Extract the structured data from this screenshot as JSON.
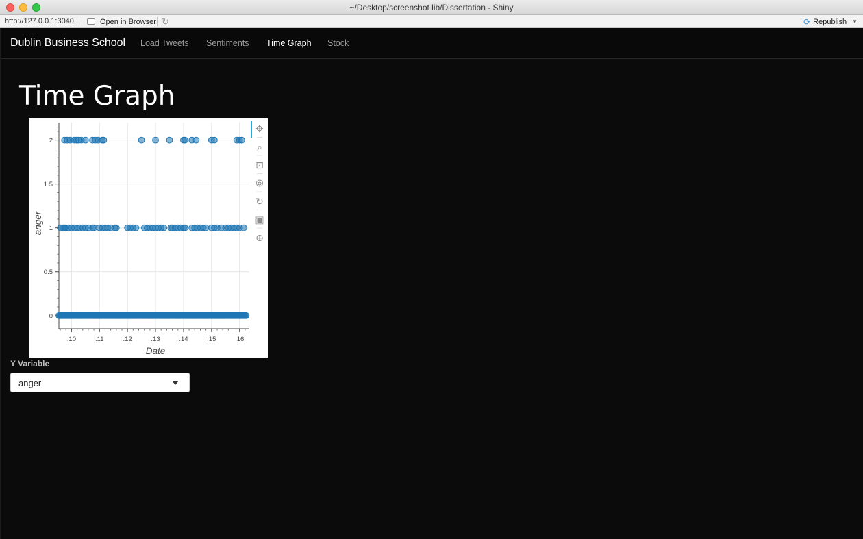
{
  "window": {
    "title": "~/Desktop/screenshot lib/Dissertation - Shiny"
  },
  "urlbar": {
    "url": "http://127.0.0.1:3040",
    "open_in_browser": "Open in Browser",
    "refresh_icon": "refresh-icon",
    "republish": "Republish"
  },
  "navbar": {
    "brand": "Dublin Business School",
    "items": [
      {
        "label": "Load Tweets",
        "active": false
      },
      {
        "label": "Sentiments",
        "active": false
      },
      {
        "label": "Time Graph",
        "active": true
      },
      {
        "label": "Stock",
        "active": false
      }
    ]
  },
  "main": {
    "title": "Time Graph",
    "y_variable_label": "Y Variable",
    "y_variable_value": "anger"
  },
  "toolbar_icons": [
    "pan-icon",
    "box-zoom-icon",
    "wheel-zoom-icon",
    "hover-icon",
    "reset-icon",
    "save-icon",
    "crosshair-icon"
  ],
  "chart_data": {
    "type": "scatter",
    "xlabel": "Date",
    "ylabel": "anger",
    "xticks": [
      ":10",
      ":11",
      ":12",
      ":13",
      ":14",
      ":15",
      ":16"
    ],
    "ylim": [
      0,
      2
    ],
    "yticks": [
      "0",
      "0.5",
      "1",
      "1.5",
      "2"
    ],
    "xlim": [
      9.55,
      16.35
    ],
    "series": [
      {
        "y": 2,
        "x": [
          9.75,
          9.85,
          9.95,
          10.1,
          10.18,
          10.25,
          10.35,
          10.5,
          10.75,
          10.85,
          10.95,
          11.1,
          11.15,
          12.5,
          13.0,
          13.5,
          14.0,
          14.05,
          14.3,
          14.45,
          15.0,
          15.1,
          15.9,
          16.0,
          16.08
        ]
      },
      {
        "y": 1,
        "x": [
          9.6,
          9.7,
          9.75,
          9.8,
          9.9,
          10.0,
          10.1,
          10.2,
          10.3,
          10.4,
          10.5,
          10.6,
          10.75,
          10.8,
          11.0,
          11.1,
          11.2,
          11.3,
          11.4,
          11.55,
          11.6,
          12.0,
          12.1,
          12.2,
          12.3,
          12.6,
          12.7,
          12.8,
          12.9,
          13.0,
          13.1,
          13.2,
          13.3,
          13.55,
          13.6,
          13.7,
          13.8,
          13.9,
          14.0,
          14.05,
          14.3,
          14.4,
          14.5,
          14.6,
          14.7,
          14.8,
          15.0,
          15.1,
          15.2,
          15.35,
          15.5,
          15.6,
          15.7,
          15.8,
          15.9,
          16.0,
          16.15
        ]
      },
      {
        "y": 0,
        "x_range": [
          9.55,
          16.25
        ]
      }
    ]
  }
}
